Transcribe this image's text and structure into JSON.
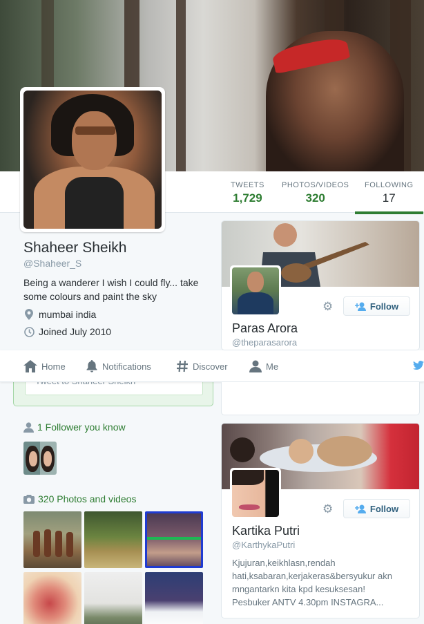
{
  "profile": {
    "name": "Shaheer Sheikh",
    "handle": "@Shaheer_S",
    "bio": "Being a wanderer I wish I could fly... take some colours and paint the sky",
    "location": "mumbai india",
    "joined": "Joined July 2010"
  },
  "stats": [
    {
      "label": "TWEETS",
      "value": "1,729"
    },
    {
      "label": "PHOTOS/VIDEOS",
      "value": "320"
    },
    {
      "label": "FOLLOWING",
      "value": "17"
    }
  ],
  "nav": {
    "home": "Home",
    "notifications": "Notifications",
    "discover": "Discover",
    "me": "Me"
  },
  "tweetbox": {
    "placeholder": "Tweet to Shaheer Sheikh"
  },
  "modules": {
    "followers_known": "1 Follower you know",
    "photos_videos": "320 Photos and videos"
  },
  "cards": [
    {
      "name": "Paras Arora",
      "handle": "@theparasarora",
      "follow_label": "Follow",
      "bio": ""
    },
    {
      "name": "Kartika Putri",
      "handle": "@KarthykaPutri",
      "follow_label": "Follow",
      "bio": "Kjujuran,keikhlasn,rendah\nhati,ksabaran,kerjakeras&bersyukur akn\nmngantarkn kita kpd kesuksesan!\nPesbuker ANTV 4.30pm INSTAGRA..."
    }
  ],
  "colors": {
    "accent": "#2e7d32",
    "link": "#2e5f7d",
    "text": "#292f33",
    "muted": "#8899a6"
  },
  "icons": [
    "location-pin-icon",
    "calendar-clock-icon",
    "home-icon",
    "bell-icon",
    "hashtag-icon",
    "person-icon",
    "twitter-bird-icon",
    "person-add-icon",
    "gear-icon",
    "camera-icon"
  ]
}
